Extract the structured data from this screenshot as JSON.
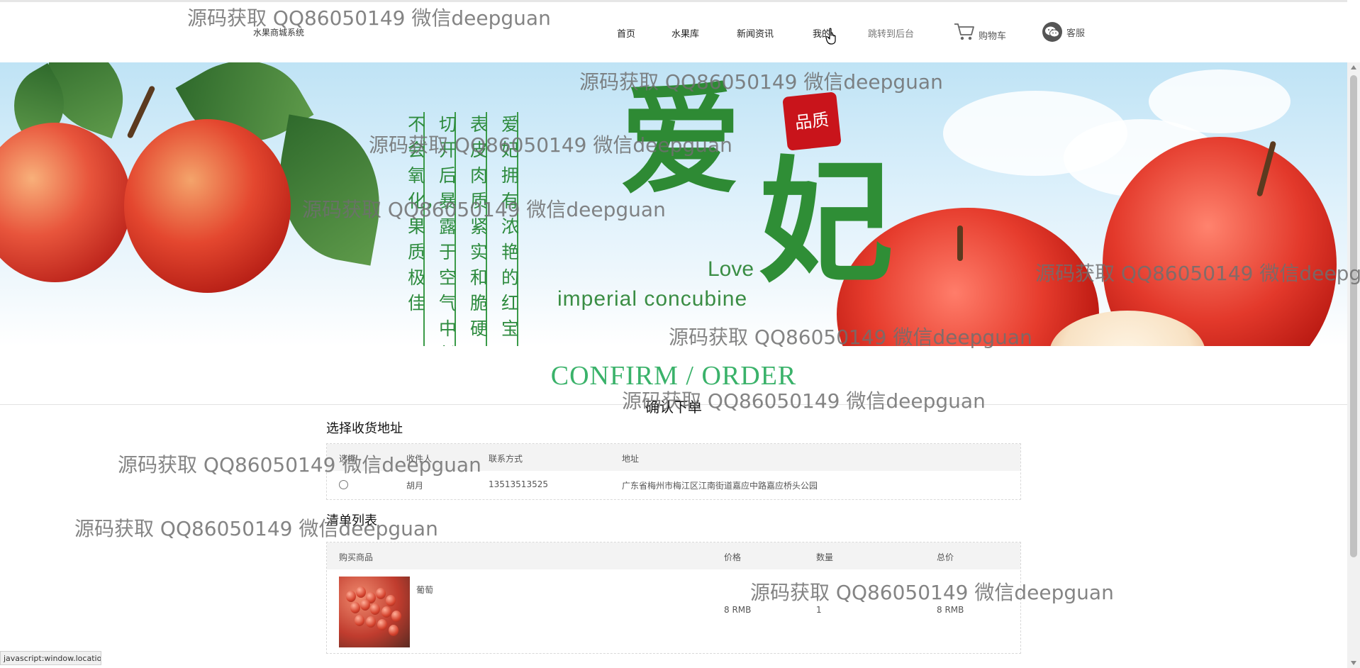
{
  "header": {
    "site_name": "水果商城系统",
    "nav": [
      {
        "label": "首页"
      },
      {
        "label": "水果库"
      },
      {
        "label": "新闻资讯"
      },
      {
        "label": "我的"
      },
      {
        "label": "跳转到后台"
      }
    ],
    "cart_label": "购物车",
    "service_label": "客服"
  },
  "banner": {
    "poem_columns": [
      "不会氧化，果质极佳",
      "切开后暴露于空气中长",
      "表皮肉质紧实和脆硬",
      "爱妃拥有浓艳的红宝"
    ],
    "title_char_1": "爱",
    "title_char_2": "妃",
    "seal_text": "品质",
    "love_text": "Love",
    "imperial_text": "imperial concubine"
  },
  "confirm": {
    "title": "CONFIRM / ORDER",
    "subtitle": "确认下单"
  },
  "address_section": {
    "title": "选择收货地址",
    "headers": [
      "选择",
      "收件人",
      "联系方式",
      "地址"
    ],
    "rows": [
      {
        "recipient": "胡月",
        "phone": "13513513525",
        "address": "广东省梅州市梅江区江南街道嘉应中路嘉应桥头公园"
      }
    ]
  },
  "order_section": {
    "title": "清单列表",
    "headers": [
      "购买商品",
      "价格",
      "数量",
      "总价"
    ],
    "items": [
      {
        "name": "葡萄",
        "price": "8 RMB",
        "quantity": "1",
        "total": "8 RMB"
      }
    ]
  },
  "statusbar": {
    "text": "javascript:window.locatio"
  },
  "watermark": "源码获取 QQ86050149 微信deepguan",
  "colors": {
    "accent_green": "#3ab26a",
    "banner_green": "#2e8a34",
    "seal_red": "#c9141b"
  },
  "icons": {
    "cart": "shopping-cart-icon",
    "service": "wechat-icon",
    "cursor": "hand-cursor-icon"
  }
}
